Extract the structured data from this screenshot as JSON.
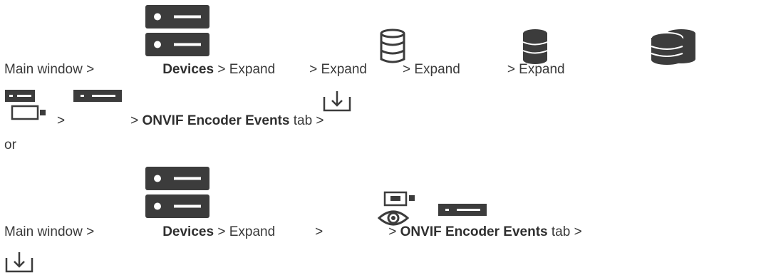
{
  "path1": {
    "main_window": "Main window >",
    "devices": "Devices",
    "expand1": "> Expand",
    "expand2": "> Expand",
    "expand3": "> Expand",
    "expand4": "> Expand",
    "sep1": ">",
    "sep2": ">",
    "onvif_tab": "ONVIF Encoder Events",
    "tab_suffix": "tab >"
  },
  "or_text": "or",
  "path2": {
    "main_window": "Main window >",
    "devices": "Devices",
    "expand1": "> Expand",
    "sep1": ">",
    "sep2": ">",
    "onvif_tab": "ONVIF Encoder Events",
    "tab_suffix": "tab >"
  },
  "icons": {
    "devices": "devices-icon",
    "db_lines": "database-icon",
    "db_solid": "database-solid-icon",
    "db_multi": "database-stack-icon",
    "encoder_monitor": "encoder-group-icon",
    "encoder": "encoder-icon",
    "import": "import-icon",
    "onvif_group": "onvif-encoder-group-icon"
  },
  "colors": {
    "icon_dark": "#3c3c3c",
    "text": "#3a3a3a"
  }
}
